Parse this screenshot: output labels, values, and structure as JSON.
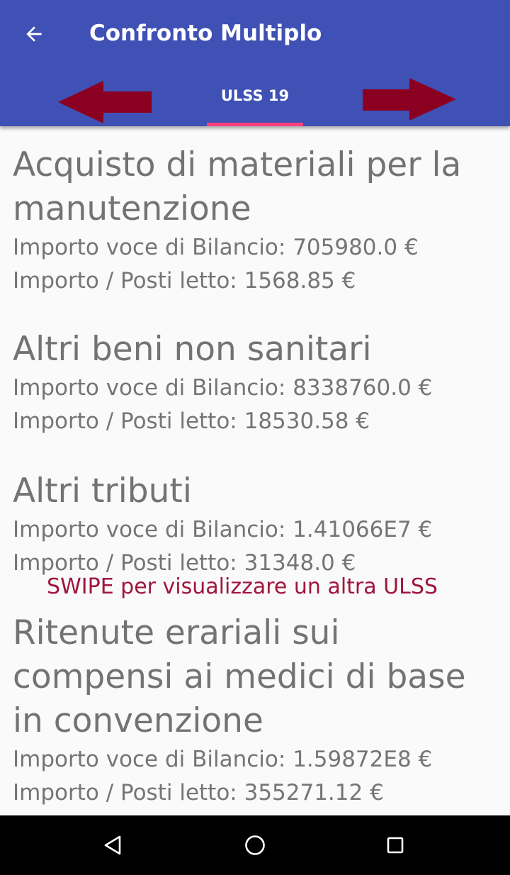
{
  "toolbar": {
    "title": "Confronto Multiplo",
    "back_icon": "arrow-back-icon"
  },
  "tabs": {
    "active_label": "ULSS 19",
    "indicator_color": "#ff4081",
    "left_arrow_icon": "red-arrow-left-icon",
    "right_arrow_icon": "red-arrow-right-icon"
  },
  "hint": "SWIPE per visualizzare un altra ULSS",
  "items": [
    {
      "title": "Acquisto di materiali per la manutenzione",
      "importo_bilancio": "Importo voce di Bilancio: 705980.0 €",
      "importo_posti": "Importo / Posti letto: 1568.85 €"
    },
    {
      "title": "Altri beni non sanitari",
      "importo_bilancio": "Importo voce di Bilancio: 8338760.0 €",
      "importo_posti": "Importo / Posti letto: 18530.58 €"
    },
    {
      "title": "Altri tributi",
      "importo_bilancio": "Importo voce di Bilancio: 1.41066E7 €",
      "importo_posti": "Importo / Posti letto: 31348.0 €"
    },
    {
      "title": "Ritenute erariali sui compensi ai medici di base in convenzione",
      "importo_bilancio": "Importo voce di Bilancio: 1.59872E8 €",
      "importo_posti": "Importo / Posti letto: 355271.12 €"
    }
  ],
  "navbar": {
    "back_icon": "nav-back-triangle-icon",
    "home_icon": "nav-home-circle-icon",
    "recents_icon": "nav-recents-square-icon"
  },
  "colors": {
    "primary": "#3f51b5",
    "accent": "#ff4081",
    "arrow": "#8b0020",
    "hint_text": "#a0153e"
  }
}
